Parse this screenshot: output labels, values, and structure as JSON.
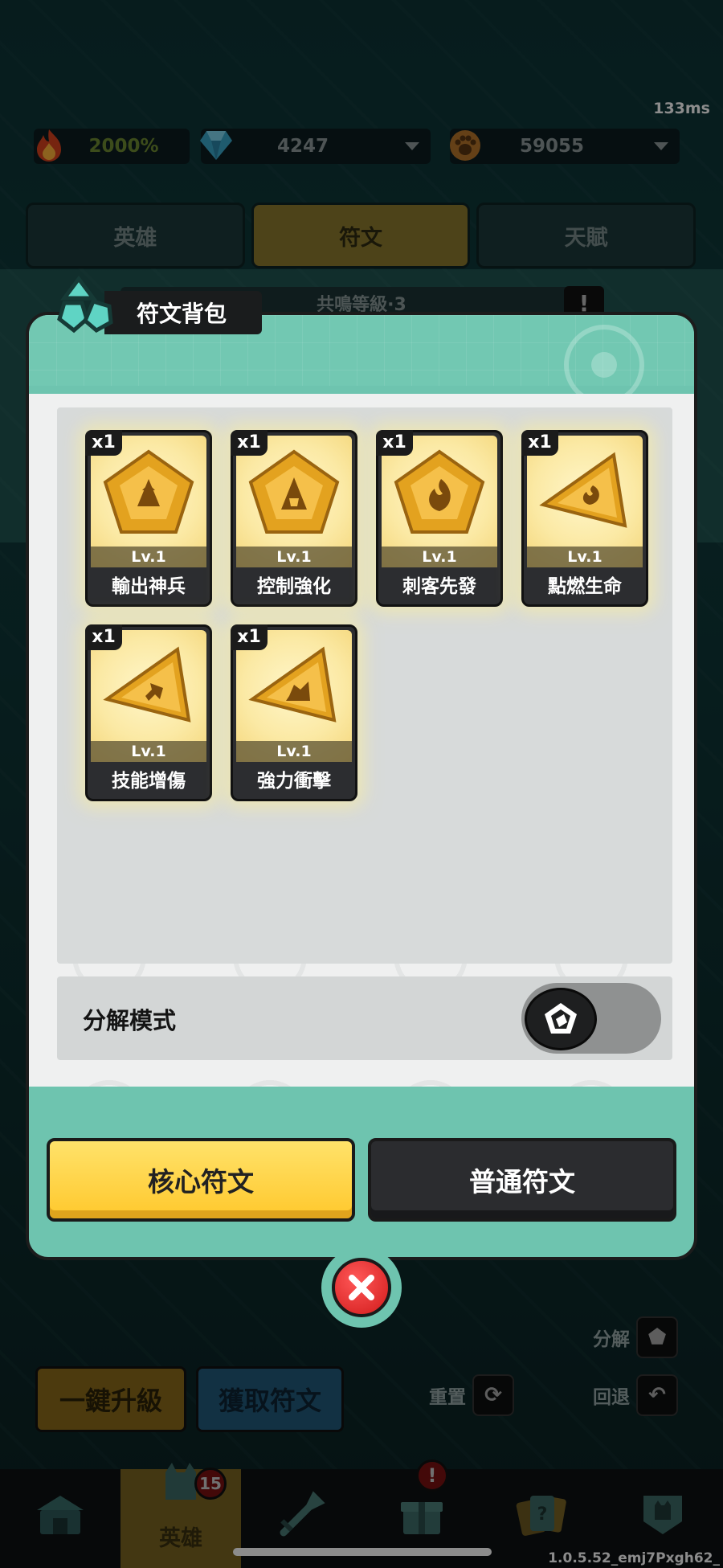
{
  "status": {
    "ping": "133ms"
  },
  "resources": {
    "fire_percent": "2000%",
    "gems": "4247",
    "paws": "59055"
  },
  "top_tabs": [
    {
      "label": "英雄"
    },
    {
      "label": "符文",
      "active": true
    },
    {
      "label": "天賦"
    }
  ],
  "background": {
    "resonance_level": "共鳴等級·3"
  },
  "modal": {
    "title": "符文背包",
    "runes": [
      {
        "qty": "x1",
        "level": "Lv.1",
        "name": "輸出神兵",
        "shape": "pentagon"
      },
      {
        "qty": "x1",
        "level": "Lv.1",
        "name": "控制強化",
        "shape": "pentagon"
      },
      {
        "qty": "x1",
        "level": "Lv.1",
        "name": "刺客先發",
        "shape": "pentagon"
      },
      {
        "qty": "x1",
        "level": "Lv.1",
        "name": "點燃生命",
        "shape": "triangle"
      },
      {
        "qty": "x1",
        "level": "Lv.1",
        "name": "技能增傷",
        "shape": "triangle"
      },
      {
        "qty": "x1",
        "level": "Lv.1",
        "name": "強力衝擊",
        "shape": "triangle"
      }
    ],
    "decompose_mode_label": "分解模式",
    "decompose_mode_on": false,
    "core_rune_button": "核心符文",
    "normal_rune_button": "普通符文"
  },
  "side_actions": {
    "decompose": "分解",
    "reset": "重置",
    "back": "回退"
  },
  "action_buttons": {
    "upgrade_all": "一鍵升級",
    "get_runes": "獲取符文"
  },
  "nav": {
    "hero_label": "英雄",
    "hero_badge": "15",
    "gift_alert": "!"
  },
  "version": "1.0.5.52_emj7Pxgh62_",
  "colors": {
    "modal_teal": "#6ec4af",
    "core_yellow": "#ffc82c",
    "close_red": "#d11b1b"
  }
}
